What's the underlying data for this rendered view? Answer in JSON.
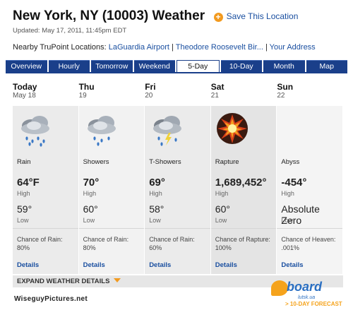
{
  "header": {
    "title": "New York, NY (10003) Weather",
    "save_label": "Save This Location",
    "updated": "Updated: May 17, 2011, 11:45pm EDT",
    "nearby_label": "Nearby TruPoint Locations:",
    "nearby_links": [
      "LaGuardia Airport",
      "Theodore Roosevelt Bir...",
      "Your Address"
    ],
    "nearby_sep": "|"
  },
  "tabs": [
    "Overview",
    "Hourly",
    "Tomorrow",
    "Weekend",
    "5-Day",
    "10-Day",
    "Month",
    "Map"
  ],
  "active_tab": "5-Day",
  "days": [
    {
      "name": "Today",
      "date": "May 18",
      "icon": "rain-cloud-icon",
      "condition": "Rain",
      "high": "64°F",
      "high_label": "High",
      "low": "59°",
      "low_label": "Low",
      "chance_label": "Chance of Rain:",
      "chance_value": "80%",
      "details": "Details"
    },
    {
      "name": "Thu",
      "date": "19",
      "icon": "showers-cloud-icon",
      "condition": "Showers",
      "high": "70°",
      "high_label": "High",
      "low": "60°",
      "low_label": "Low",
      "chance_label": "Chance of Rain:",
      "chance_value": "80%",
      "details": "Details"
    },
    {
      "name": "Fri",
      "date": "20",
      "icon": "thunder-showers-cloud-icon",
      "condition": "T-Showers",
      "high": "69°",
      "high_label": "High",
      "low": "58°",
      "low_label": "Low",
      "chance_label": "Chance of Rain:",
      "chance_value": "60%",
      "details": "Details"
    },
    {
      "name": "Sat",
      "date": "21",
      "icon": "explosion-icon",
      "condition": "Rapture",
      "high": "1,689,452°",
      "high_label": "High",
      "low": "60°",
      "low_label": "Low",
      "chance_label": "Chance of Rapture:",
      "chance_value": "100%",
      "details": "Details"
    },
    {
      "name": "Sun",
      "date": "22",
      "icon": "",
      "condition": "Abyss",
      "high": "-454°",
      "high_label": "High",
      "low": "Absolute Zero",
      "low_label": "Low",
      "chance_label": "Chance of Heaven:",
      "chance_value": ".001%",
      "details": "Details"
    }
  ],
  "expand_label": "EXPAND WEATHER DETAILS",
  "credit": "WiseguyPictures.net",
  "logo": {
    "word": "board",
    "sub": "lutsk.ua",
    "forecast": "> 10-DAY FORECAST"
  },
  "colors": {
    "accent": "#f29a1f",
    "tab_bg": "#1a3f8a",
    "link": "#1a4fa0"
  }
}
